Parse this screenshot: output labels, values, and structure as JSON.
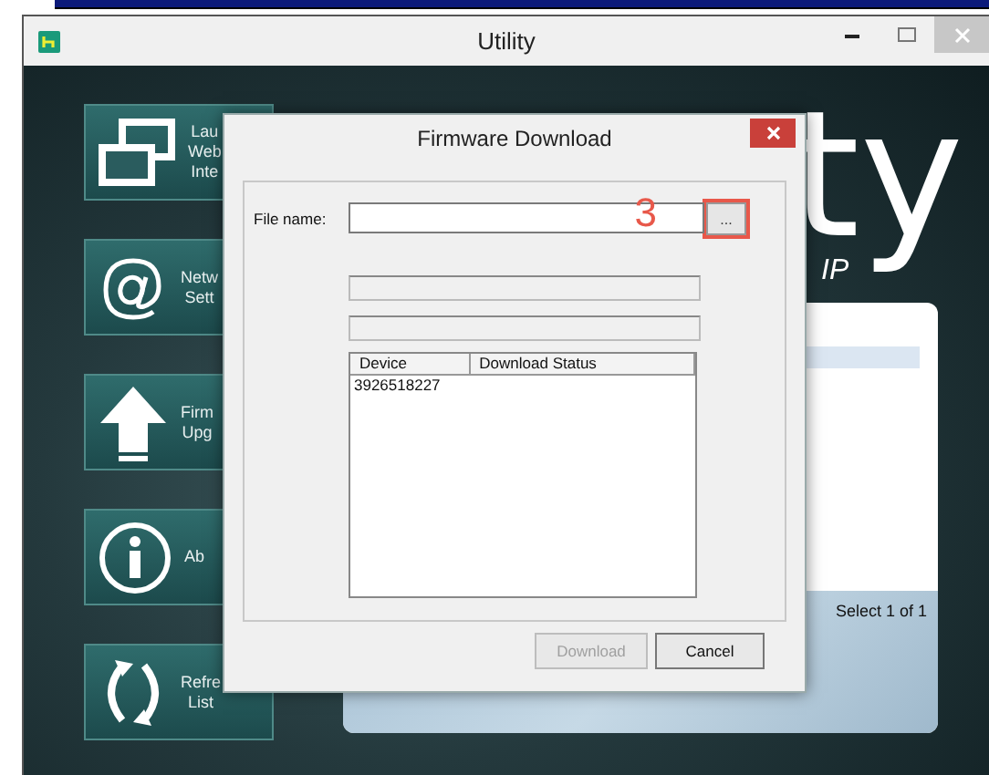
{
  "window": {
    "title": "Utility"
  },
  "sidebar": {
    "items": [
      {
        "kind": "windows",
        "lines": [
          "Lau",
          "Web",
          "Inte"
        ]
      },
      {
        "kind": "at",
        "lines": [
          "Netw",
          "Sett"
        ]
      },
      {
        "kind": "upload",
        "lines": [
          "Firm",
          "Upg"
        ]
      },
      {
        "kind": "info",
        "lines": [
          "Ab"
        ]
      },
      {
        "kind": "refresh",
        "lines": [
          "Refre",
          "List"
        ]
      }
    ]
  },
  "logo": {
    "text": "ty",
    "subtitle": "IP"
  },
  "device_panel": {
    "rows": [
      {
        "selected": true
      }
    ],
    "status": "Select 1 of 1"
  },
  "dialog": {
    "title": "Firmware Download",
    "file_label": "File name:",
    "browse_button": "...",
    "annotation": "3",
    "status_fields": [
      {
        "disabled": true
      },
      {
        "disabled": true
      }
    ],
    "table": {
      "columns": [
        "Device",
        "Download Status"
      ],
      "rows": [
        {
          "device": "3926518227"
        }
      ]
    },
    "buttons": [
      {
        "label": "Download",
        "disabled": true
      },
      {
        "label": "Cancel",
        "disabled": false
      }
    ]
  }
}
